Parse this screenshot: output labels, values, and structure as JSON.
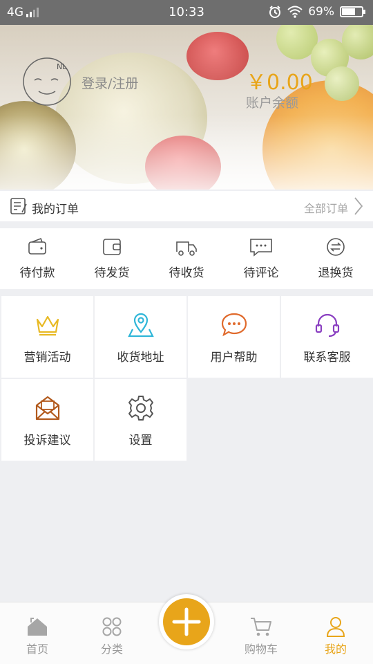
{
  "status_bar": {
    "network": "4G",
    "time": "10:33",
    "battery": "69%",
    "battery_level": 0.69
  },
  "header": {
    "login_text": "登录/注册",
    "balance": "￥0.00",
    "balance_label": "账户余额",
    "avatar_text": "NL"
  },
  "orders": {
    "title": "我的订单",
    "all_label": "全部订单",
    "statuses": [
      {
        "label": "待付款",
        "icon": "wallet-icon"
      },
      {
        "label": "待发货",
        "icon": "purse-icon"
      },
      {
        "label": "待收货",
        "icon": "truck-icon"
      },
      {
        "label": "待评论",
        "icon": "comment-icon"
      },
      {
        "label": "退换货",
        "icon": "exchange-icon"
      }
    ]
  },
  "services": [
    {
      "label": "营销活动",
      "icon": "crown-icon",
      "color": "#e8b923"
    },
    {
      "label": "收货地址",
      "icon": "location-icon",
      "color": "#2fb6d8"
    },
    {
      "label": "用户帮助",
      "icon": "chat-bubble-icon",
      "color": "#e06a2c"
    },
    {
      "label": "联系客服",
      "icon": "headset-icon",
      "color": "#8a3fc1"
    },
    {
      "label": "投诉建议",
      "icon": "envelope-icon",
      "color": "#b25a1d"
    },
    {
      "label": "设置",
      "icon": "gear-icon",
      "color": "#555555"
    }
  ],
  "tabbar": {
    "items": [
      {
        "label": "首页",
        "icon": "home-icon"
      },
      {
        "label": "分类",
        "icon": "category-icon"
      },
      {
        "label": "购物车",
        "icon": "cart-icon"
      },
      {
        "label": "我的",
        "icon": "user-icon"
      }
    ],
    "active_index": 3,
    "accent": "#e8a51a"
  }
}
